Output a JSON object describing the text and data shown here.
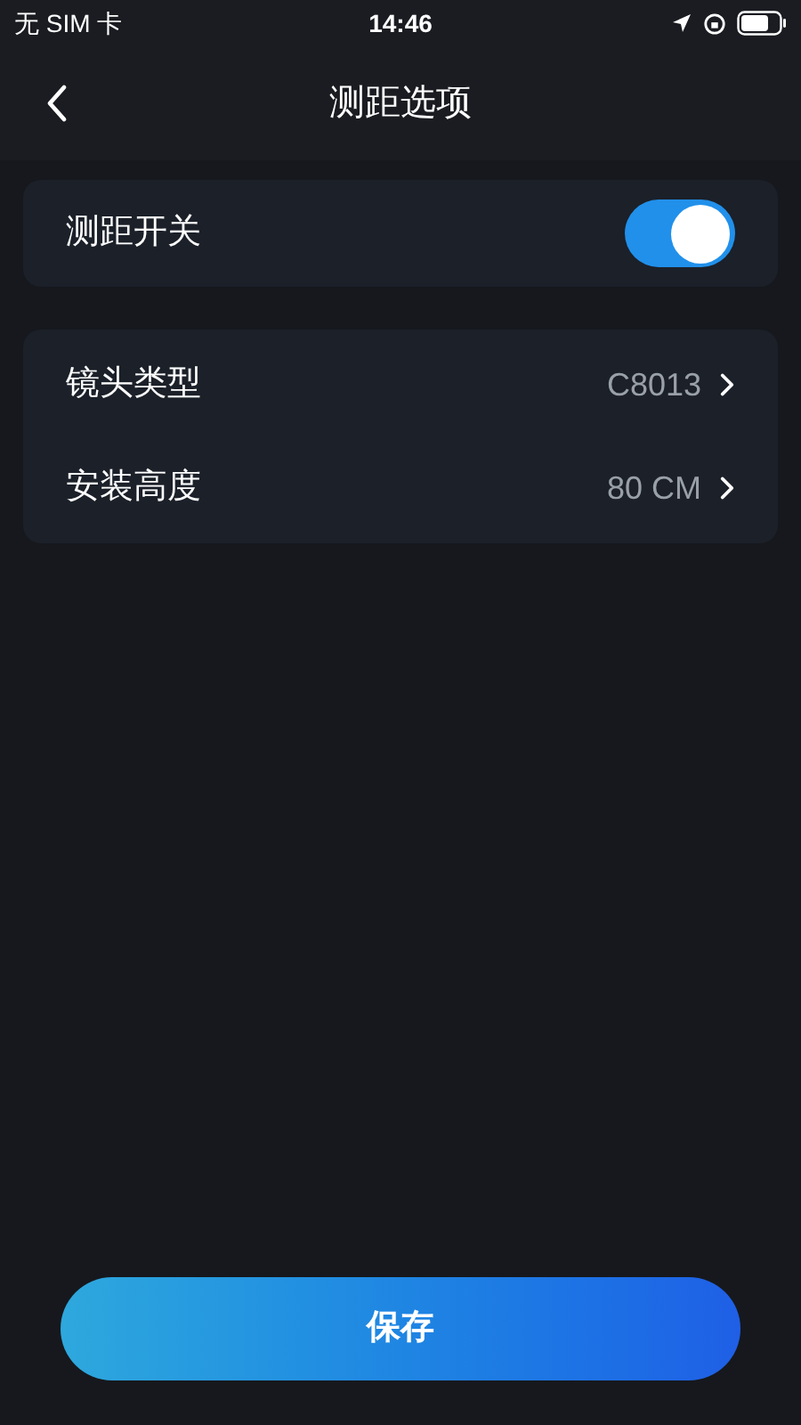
{
  "status_bar": {
    "carrier": "无 SIM 卡",
    "time": "14:46"
  },
  "nav": {
    "title": "测距选项"
  },
  "toggle_row": {
    "label": "测距开关",
    "on": true
  },
  "settings": [
    {
      "label": "镜头类型",
      "value": "C8013"
    },
    {
      "label": "安装高度",
      "value": "80 CM"
    }
  ],
  "save_button": "保存"
}
